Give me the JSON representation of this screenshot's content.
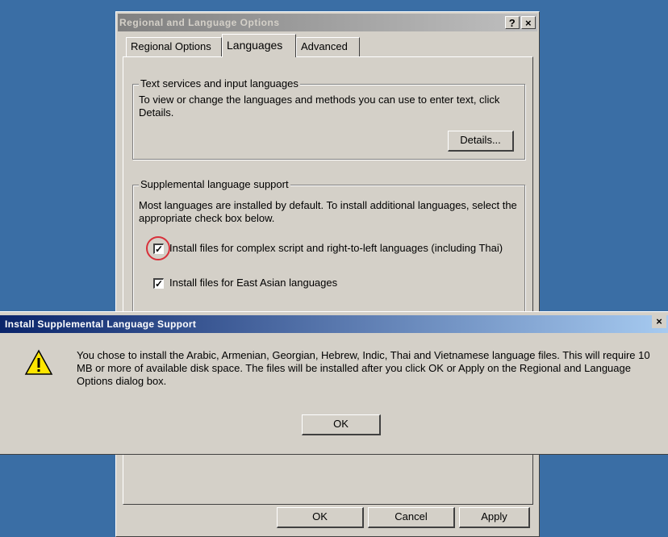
{
  "main_window": {
    "title": "Regional and Language Options",
    "help_btn": "?",
    "close_btn": "×",
    "tabs": [
      {
        "label": "Regional Options"
      },
      {
        "label": "Languages"
      },
      {
        "label": "Advanced"
      }
    ],
    "text_services": {
      "title": "Text services and input languages",
      "description": "To view or change the languages and methods you can use to enter text, click Details.",
      "details_label": "Details..."
    },
    "supplemental": {
      "title": "Supplemental language support",
      "description": "Most languages are installed by default. To install additional languages, select the appropriate check box below.",
      "complex_script_label": "Install files for complex script and right-to-left languages (including Thai)",
      "complex_script_checked": true,
      "east_asian_label": "Install files for East Asian languages",
      "east_asian_checked": true
    },
    "buttons": {
      "ok": "OK",
      "cancel": "Cancel",
      "apply": "Apply"
    }
  },
  "dialog": {
    "title": "Install Supplemental Language Support",
    "close_btn": "×",
    "icon": "warning-icon",
    "message": "You chose to install the Arabic, Armenian, Georgian, Hebrew, Indic, Thai and Vietnamese language files. This will require 10 MB or more of available disk space. The files will be installed after you click OK or Apply on the Regional and Language Options dialog box.",
    "ok_label": "OK"
  },
  "colors": {
    "desktop": "#3a6ea5",
    "dialog_title_active": "#0a246a",
    "highlight_circle": "#d8303a",
    "active_tab_text": "#000000"
  }
}
